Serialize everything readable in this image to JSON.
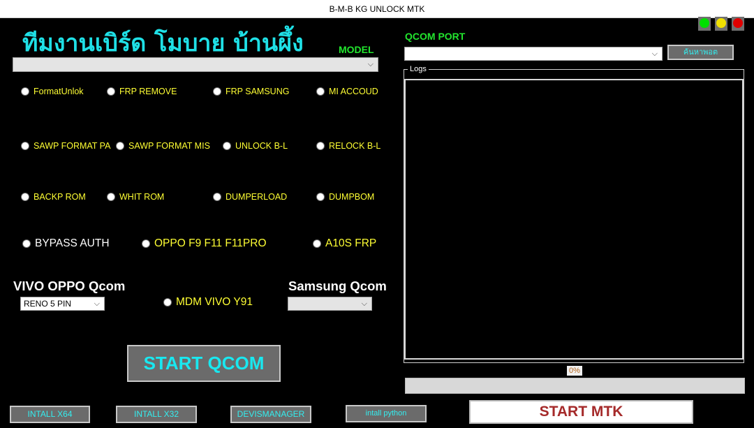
{
  "window": {
    "title": "B-M-B KG UNLOCK MTK"
  },
  "app_title": "ทีมงานเบิร์ด โมบาย บ้านผึ้ง",
  "model": {
    "label": "MODEL",
    "value": ""
  },
  "options_row1": [
    "FormatUnlok",
    "FRP REMOVE",
    "FRP SAMSUNG",
    "MI ACCOUD"
  ],
  "options_row2": [
    "SAWP FORMAT PA",
    "SAWP FORMAT MIS",
    "UNLOCK B-L",
    "RELOCK B-L"
  ],
  "options_row3": [
    "BACKP ROM",
    "WHIT ROM",
    "DUMPERLOAD",
    "DUMPBOM"
  ],
  "options_row4": [
    "BYPASS AUTH",
    "OPPO F9 F11 F11PRO",
    "A10S FRP"
  ],
  "vivo_oppo": {
    "label": "VIVO OPPO Qcom",
    "selected": "RENO 5 PIN"
  },
  "mdm_vivo": "MDM VIVO Y91",
  "samsung": {
    "label": "Samsung Qcom",
    "selected": ""
  },
  "start_qcom": "START QCOM",
  "qcom_port": {
    "label": "QCOM PORT",
    "value": "",
    "search_button": "ค้นหาพอต"
  },
  "logs": {
    "label": "Logs",
    "content": ""
  },
  "progress": {
    "text": "0%",
    "value": 0
  },
  "bottom_buttons": {
    "intall_x64": "INTALL X64",
    "intall_x32": "INTALL X32",
    "devismanager": "DEVISMANAGER",
    "intall_python": "intall python"
  },
  "start_mtk": "START MTK",
  "status_lights": {
    "green": "#00e000",
    "yellow": "#f0e000",
    "red": "#e00000"
  },
  "icons": {
    "dropdown": "chevron-down-icon"
  }
}
